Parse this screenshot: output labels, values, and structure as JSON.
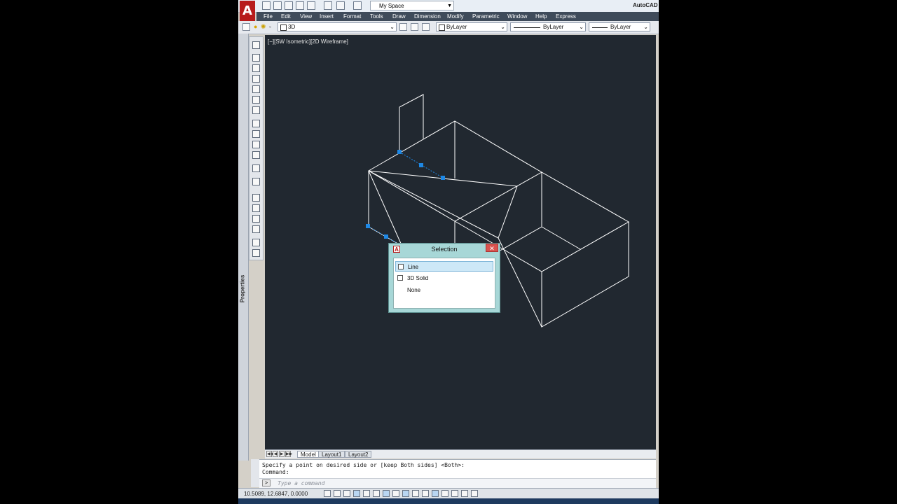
{
  "app": {
    "title": "AutoCAD",
    "logo": "A"
  },
  "workspace": {
    "value": "My Space"
  },
  "menu": [
    "File",
    "Edit",
    "View",
    "Insert",
    "Format",
    "Tools",
    "Draw",
    "Dimension",
    "Modify",
    "Parametric",
    "Window",
    "Help",
    "Express"
  ],
  "toolbar": {
    "layer_value": "3D",
    "color_value": "ByLayer",
    "linetype_value": "ByLayer",
    "lineweight_value": "ByLayer"
  },
  "viewport": {
    "label": "[−][SW Isometric][2D Wireframe]",
    "background": "#212830",
    "line_color": "#ffffff",
    "grip_color": "#1e88e5"
  },
  "side_panel": {
    "label": "Properties"
  },
  "layout_tabs": {
    "nav": [
      "◀◀",
      "◀",
      "▶",
      "▶▶"
    ],
    "tabs": [
      "Model",
      "Layout1",
      "Layout2"
    ],
    "active": "Model"
  },
  "command": {
    "line1": "Specify a point on desired side or [keep Both sides] <Both>:",
    "line2": "Command:",
    "placeholder": "Type a command",
    "prompt_icon": ">"
  },
  "status": {
    "coords": "10.5089, 12.6847, 0.0000"
  },
  "dialog": {
    "title": "Selection",
    "close": "✕",
    "app_icon": "A",
    "items": [
      {
        "label": "Line",
        "selected": true,
        "has_checkbox": true
      },
      {
        "label": "3D Solid",
        "selected": false,
        "has_checkbox": true
      },
      {
        "label": "None",
        "selected": false,
        "has_checkbox": false
      }
    ]
  }
}
